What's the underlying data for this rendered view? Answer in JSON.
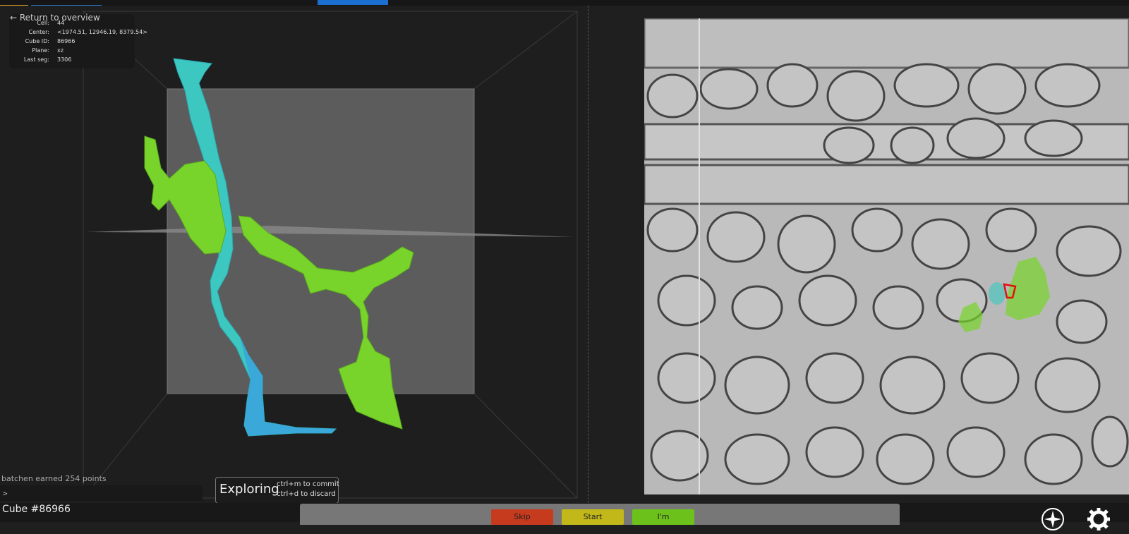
{
  "header": {
    "return_label": "← Return to overview"
  },
  "info": {
    "rows": [
      {
        "key": "Cell:",
        "value": "44"
      },
      {
        "key": "Center:",
        "value": "<1974.51, 12946.19, 8379.54>"
      },
      {
        "key": "Cube ID:",
        "value": "86966"
      },
      {
        "key": "Plane:",
        "value": "xz"
      },
      {
        "key": "Last seg:",
        "value": "3306"
      }
    ]
  },
  "chat": {
    "last_message": "batchen earned 254 points",
    "prompt": ">"
  },
  "mode": {
    "title": "Exploring",
    "commit_hint": "ctrl+m to commit",
    "discard_hint": "ctrl+d to discard"
  },
  "footer": {
    "cube_label": "Cube #86966",
    "skip_label": "Skip",
    "start_label": "Start",
    "done_label": "I'm"
  },
  "colors": {
    "accent_tab": "#1a6fd0",
    "skip": "#c63a1e",
    "start": "#c2b81a",
    "done": "#6cc21a",
    "segment_green": "#78d42a",
    "segment_cyan": "#3cc8c0",
    "cursor_red": "#e01010"
  },
  "icons": {
    "compass": "compass-icon",
    "settings": "gear-icon"
  }
}
